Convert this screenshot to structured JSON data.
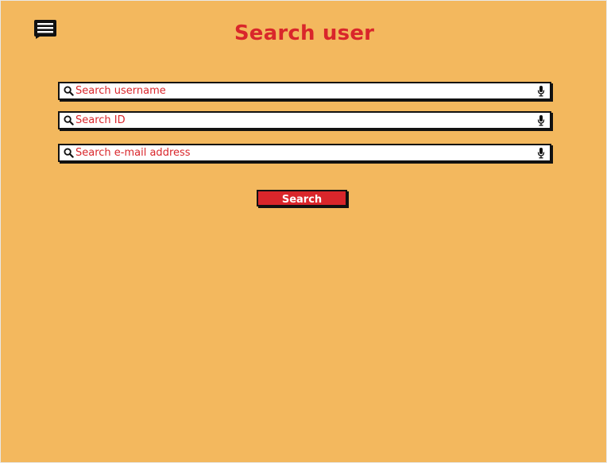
{
  "page": {
    "title": "Search user"
  },
  "icons": {
    "menu": "menu-icon",
    "search": "search-icon",
    "microphone": "microphone-icon"
  },
  "colors": {
    "background": "#f3b85e",
    "accent": "#d9262b",
    "field_background": "#ffffff",
    "outline": "#111111"
  },
  "fields": {
    "username": {
      "placeholder": "Search username",
      "value": ""
    },
    "id": {
      "placeholder": "Search ID",
      "value": ""
    },
    "email": {
      "placeholder": "Search e-mail address",
      "value": ""
    }
  },
  "actions": {
    "search_label": "Search"
  }
}
